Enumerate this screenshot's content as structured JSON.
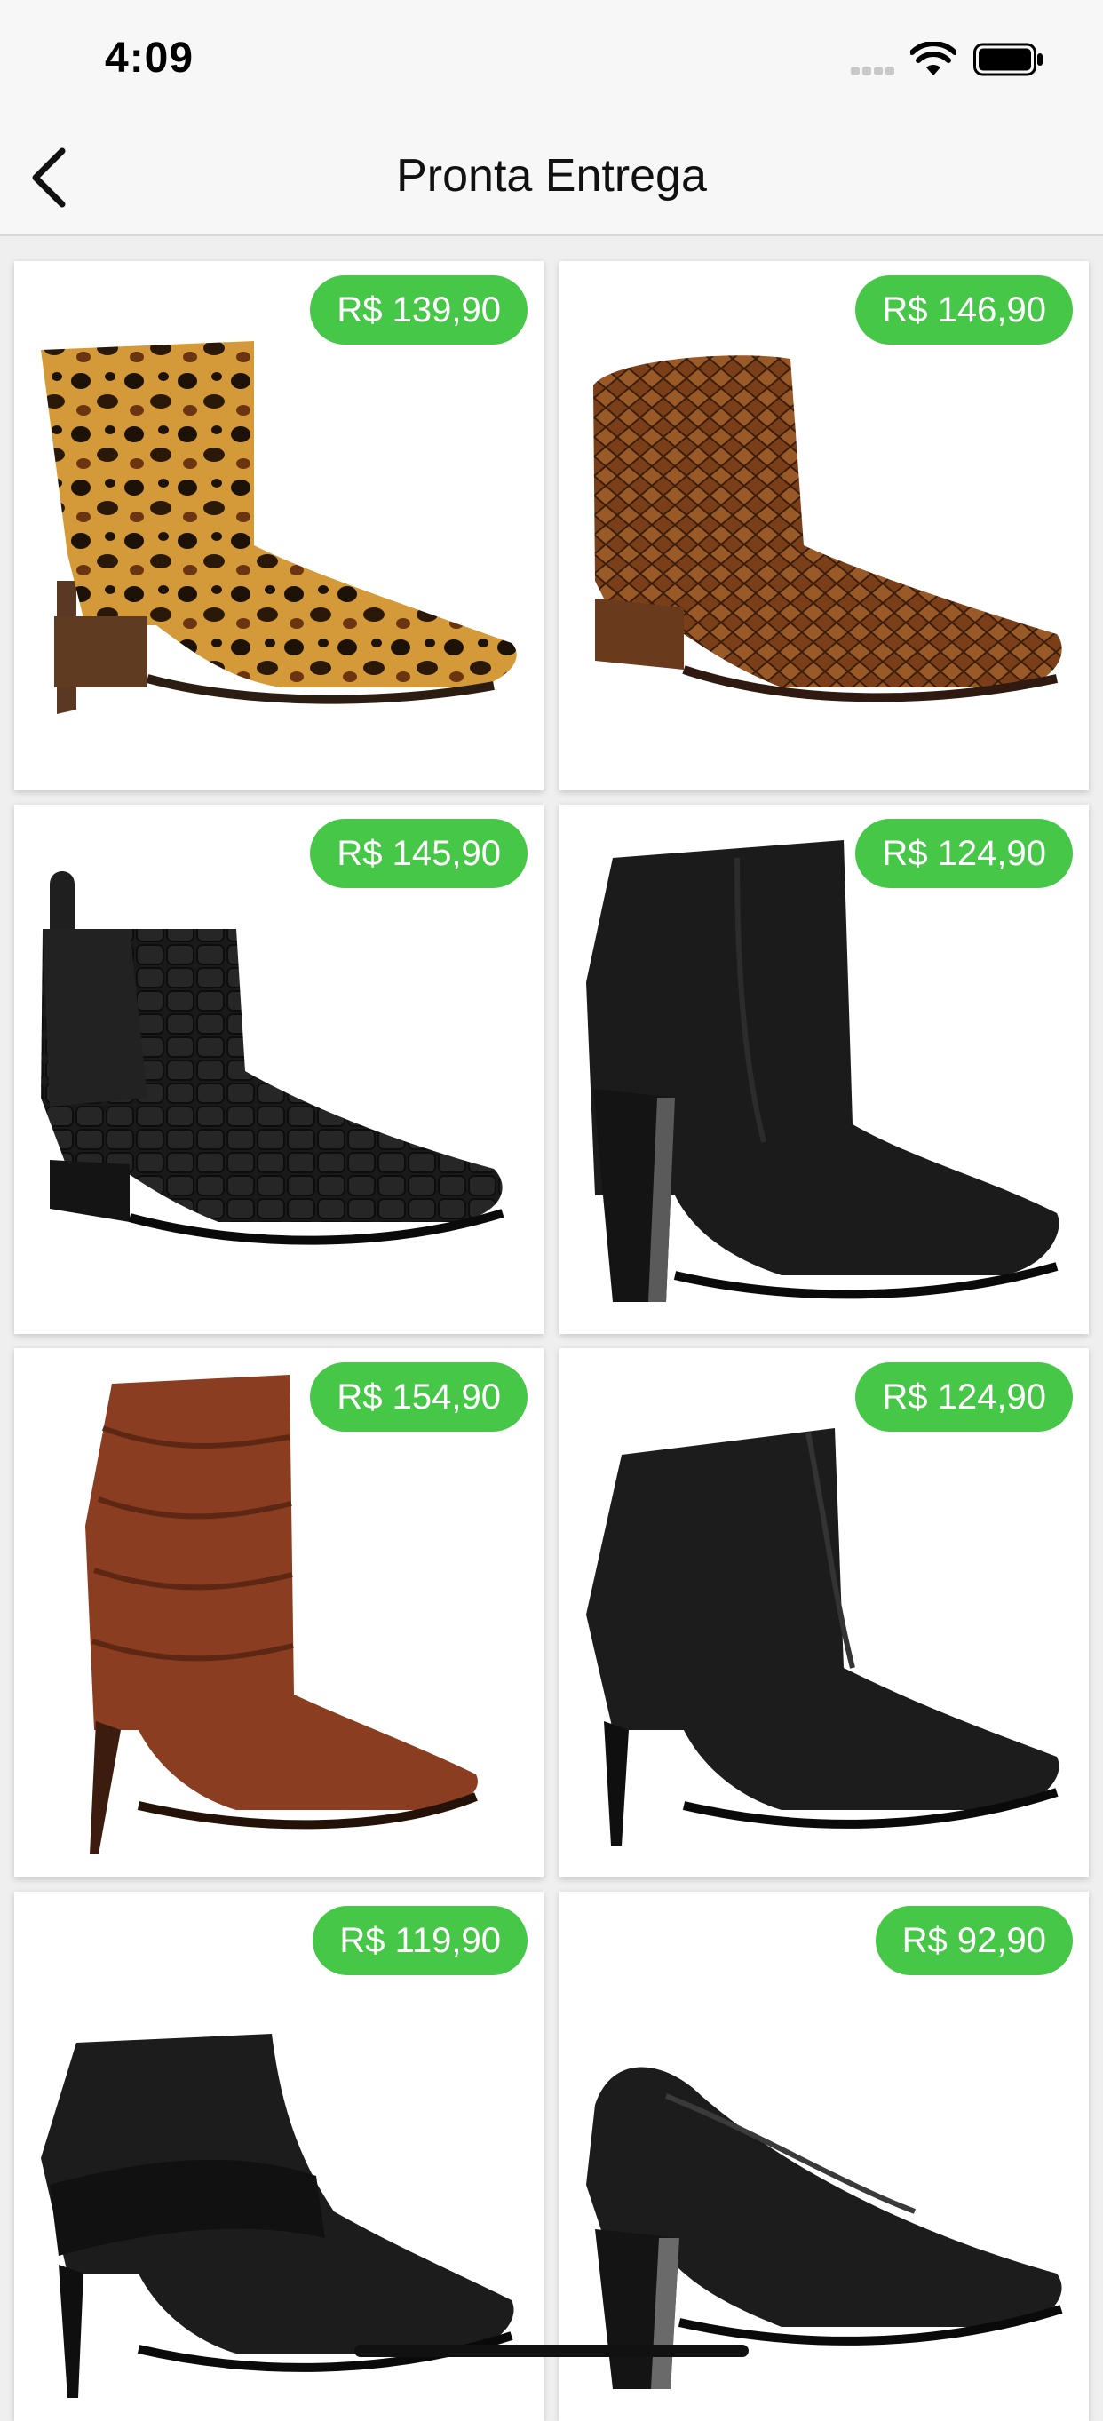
{
  "status_bar": {
    "time": "4:09"
  },
  "nav": {
    "title": "Pronta Entrega",
    "back_icon": "chevron-left-icon"
  },
  "accent_color": "#47c748",
  "products": [
    {
      "price": "R$ 139,90",
      "style": "leopard print ankle boot"
    },
    {
      "price": "R$ 146,90",
      "style": "snakeskin cowboy ankle boot"
    },
    {
      "price": "R$ 145,90",
      "style": "black croc chelsea boot"
    },
    {
      "price": "R$ 124,90",
      "style": "black block heel ankle boot"
    },
    {
      "price": "R$ 154,90",
      "style": "brown slouch stiletto boot"
    },
    {
      "price": "R$ 124,90",
      "style": "black stiletto ankle boot"
    },
    {
      "price": "R$ 119,90",
      "style": "black strap stiletto bootie"
    },
    {
      "price": "R$ 92,90",
      "style": "black block heel pump"
    }
  ]
}
